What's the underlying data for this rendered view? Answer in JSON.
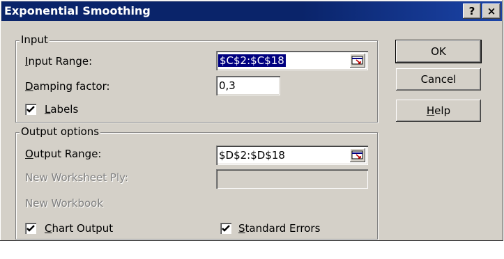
{
  "window": {
    "title": "Exponential Smoothing",
    "help_glyph": "?",
    "close_glyph": "×"
  },
  "input_group": {
    "legend": "Input",
    "input_range": {
      "label_key": "I",
      "label_rest": "nput Range:",
      "value": "$C$2:$C$18"
    },
    "damping": {
      "label_key": "D",
      "label_rest": "amping factor:",
      "value": "0,3"
    },
    "labels": {
      "label_key": "L",
      "label_rest": "abels",
      "checked": true
    }
  },
  "output_group": {
    "legend": "Output options",
    "output_range": {
      "label_key": "O",
      "label_rest": "utput Range:",
      "value": "$D$2:$D$18"
    },
    "new_worksheet": {
      "label": "New Worksheet Ply:",
      "value": ""
    },
    "new_workbook": {
      "label": "New Workbook"
    },
    "chart_output": {
      "label_key": "C",
      "label_rest": "hart Output",
      "checked": true
    },
    "standard_errors": {
      "label_key": "S",
      "label_rest": "tandard Errors",
      "checked": true
    }
  },
  "buttons": {
    "ok": "OK",
    "cancel": "Cancel",
    "help_key": "H",
    "help_rest": "elp"
  },
  "icons": [
    "range-select-icon",
    "checkmark-icon",
    "close-icon",
    "help-icon"
  ]
}
